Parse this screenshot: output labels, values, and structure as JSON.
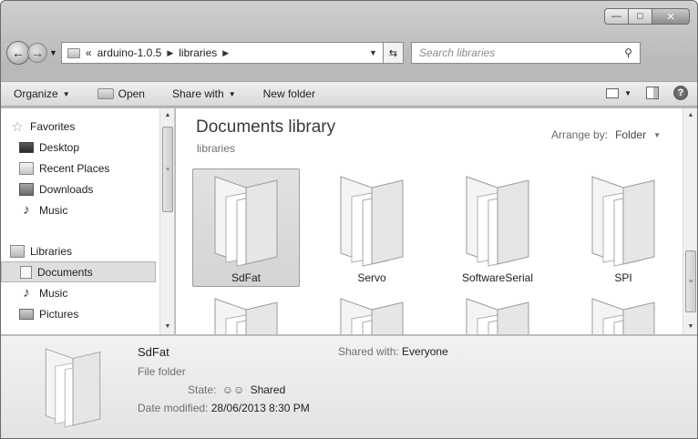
{
  "window": {
    "caption": {
      "minimize": "—",
      "maximize": "□",
      "close": "✕"
    }
  },
  "address": {
    "overflow": "«",
    "crumbs": [
      "arduino-1.0.5",
      "libraries"
    ],
    "search_placeholder": "Search libraries"
  },
  "toolbar": {
    "organize": "Organize",
    "open": "Open",
    "share_with": "Share with",
    "new_folder": "New folder"
  },
  "sidebar": {
    "favorites_label": "Favorites",
    "favorites": [
      "Desktop",
      "Recent Places",
      "Downloads",
      "Music"
    ],
    "libraries_label": "Libraries",
    "libraries": [
      "Documents",
      "Music",
      "Pictures"
    ]
  },
  "main": {
    "title": "Documents library",
    "subtitle": "libraries",
    "arrange_label": "Arrange by:",
    "arrange_value": "Folder",
    "folders": [
      "SdFat",
      "Servo",
      "SoftwareSerial",
      "SPI"
    ],
    "selected_index": 0
  },
  "details": {
    "name": "SdFat",
    "type": "File folder",
    "shared_with_label": "Shared with:",
    "shared_with_value": "Everyone",
    "state_label": "State:",
    "state_value": "Shared",
    "date_label": "Date modified:",
    "date_value": "28/06/2013 8:30 PM"
  },
  "colors": {
    "chrome": "#c4c4c4",
    "selection": "#dedede"
  }
}
